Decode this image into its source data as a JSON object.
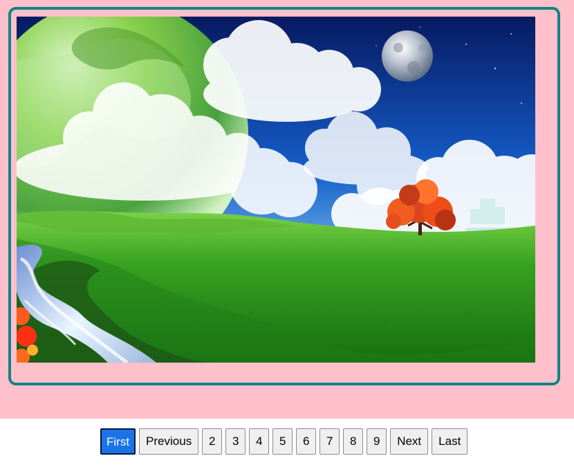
{
  "gallery": {
    "image": {
      "alt": "",
      "elements": [
        "planet",
        "moon",
        "clouds",
        "green-hills",
        "red-tree",
        "stream",
        "red-flower"
      ]
    }
  },
  "pagination": {
    "buttons": [
      {
        "label": "First",
        "state": "active"
      },
      {
        "label": "Previous",
        "state": "normal"
      },
      {
        "label": "2",
        "state": "normal"
      },
      {
        "label": "3",
        "state": "normal"
      },
      {
        "label": "4",
        "state": "normal"
      },
      {
        "label": "5",
        "state": "normal"
      },
      {
        "label": "6",
        "state": "normal"
      },
      {
        "label": "7",
        "state": "normal"
      },
      {
        "label": "8",
        "state": "normal"
      },
      {
        "label": "9",
        "state": "normal"
      },
      {
        "label": "Next",
        "state": "normal"
      },
      {
        "label": "Last",
        "state": "normal"
      }
    ]
  },
  "colors": {
    "pink_background": "#ffc0cb",
    "frame_border": "#128386",
    "active_button": "#1b73e8",
    "button_background": "#efefef"
  }
}
